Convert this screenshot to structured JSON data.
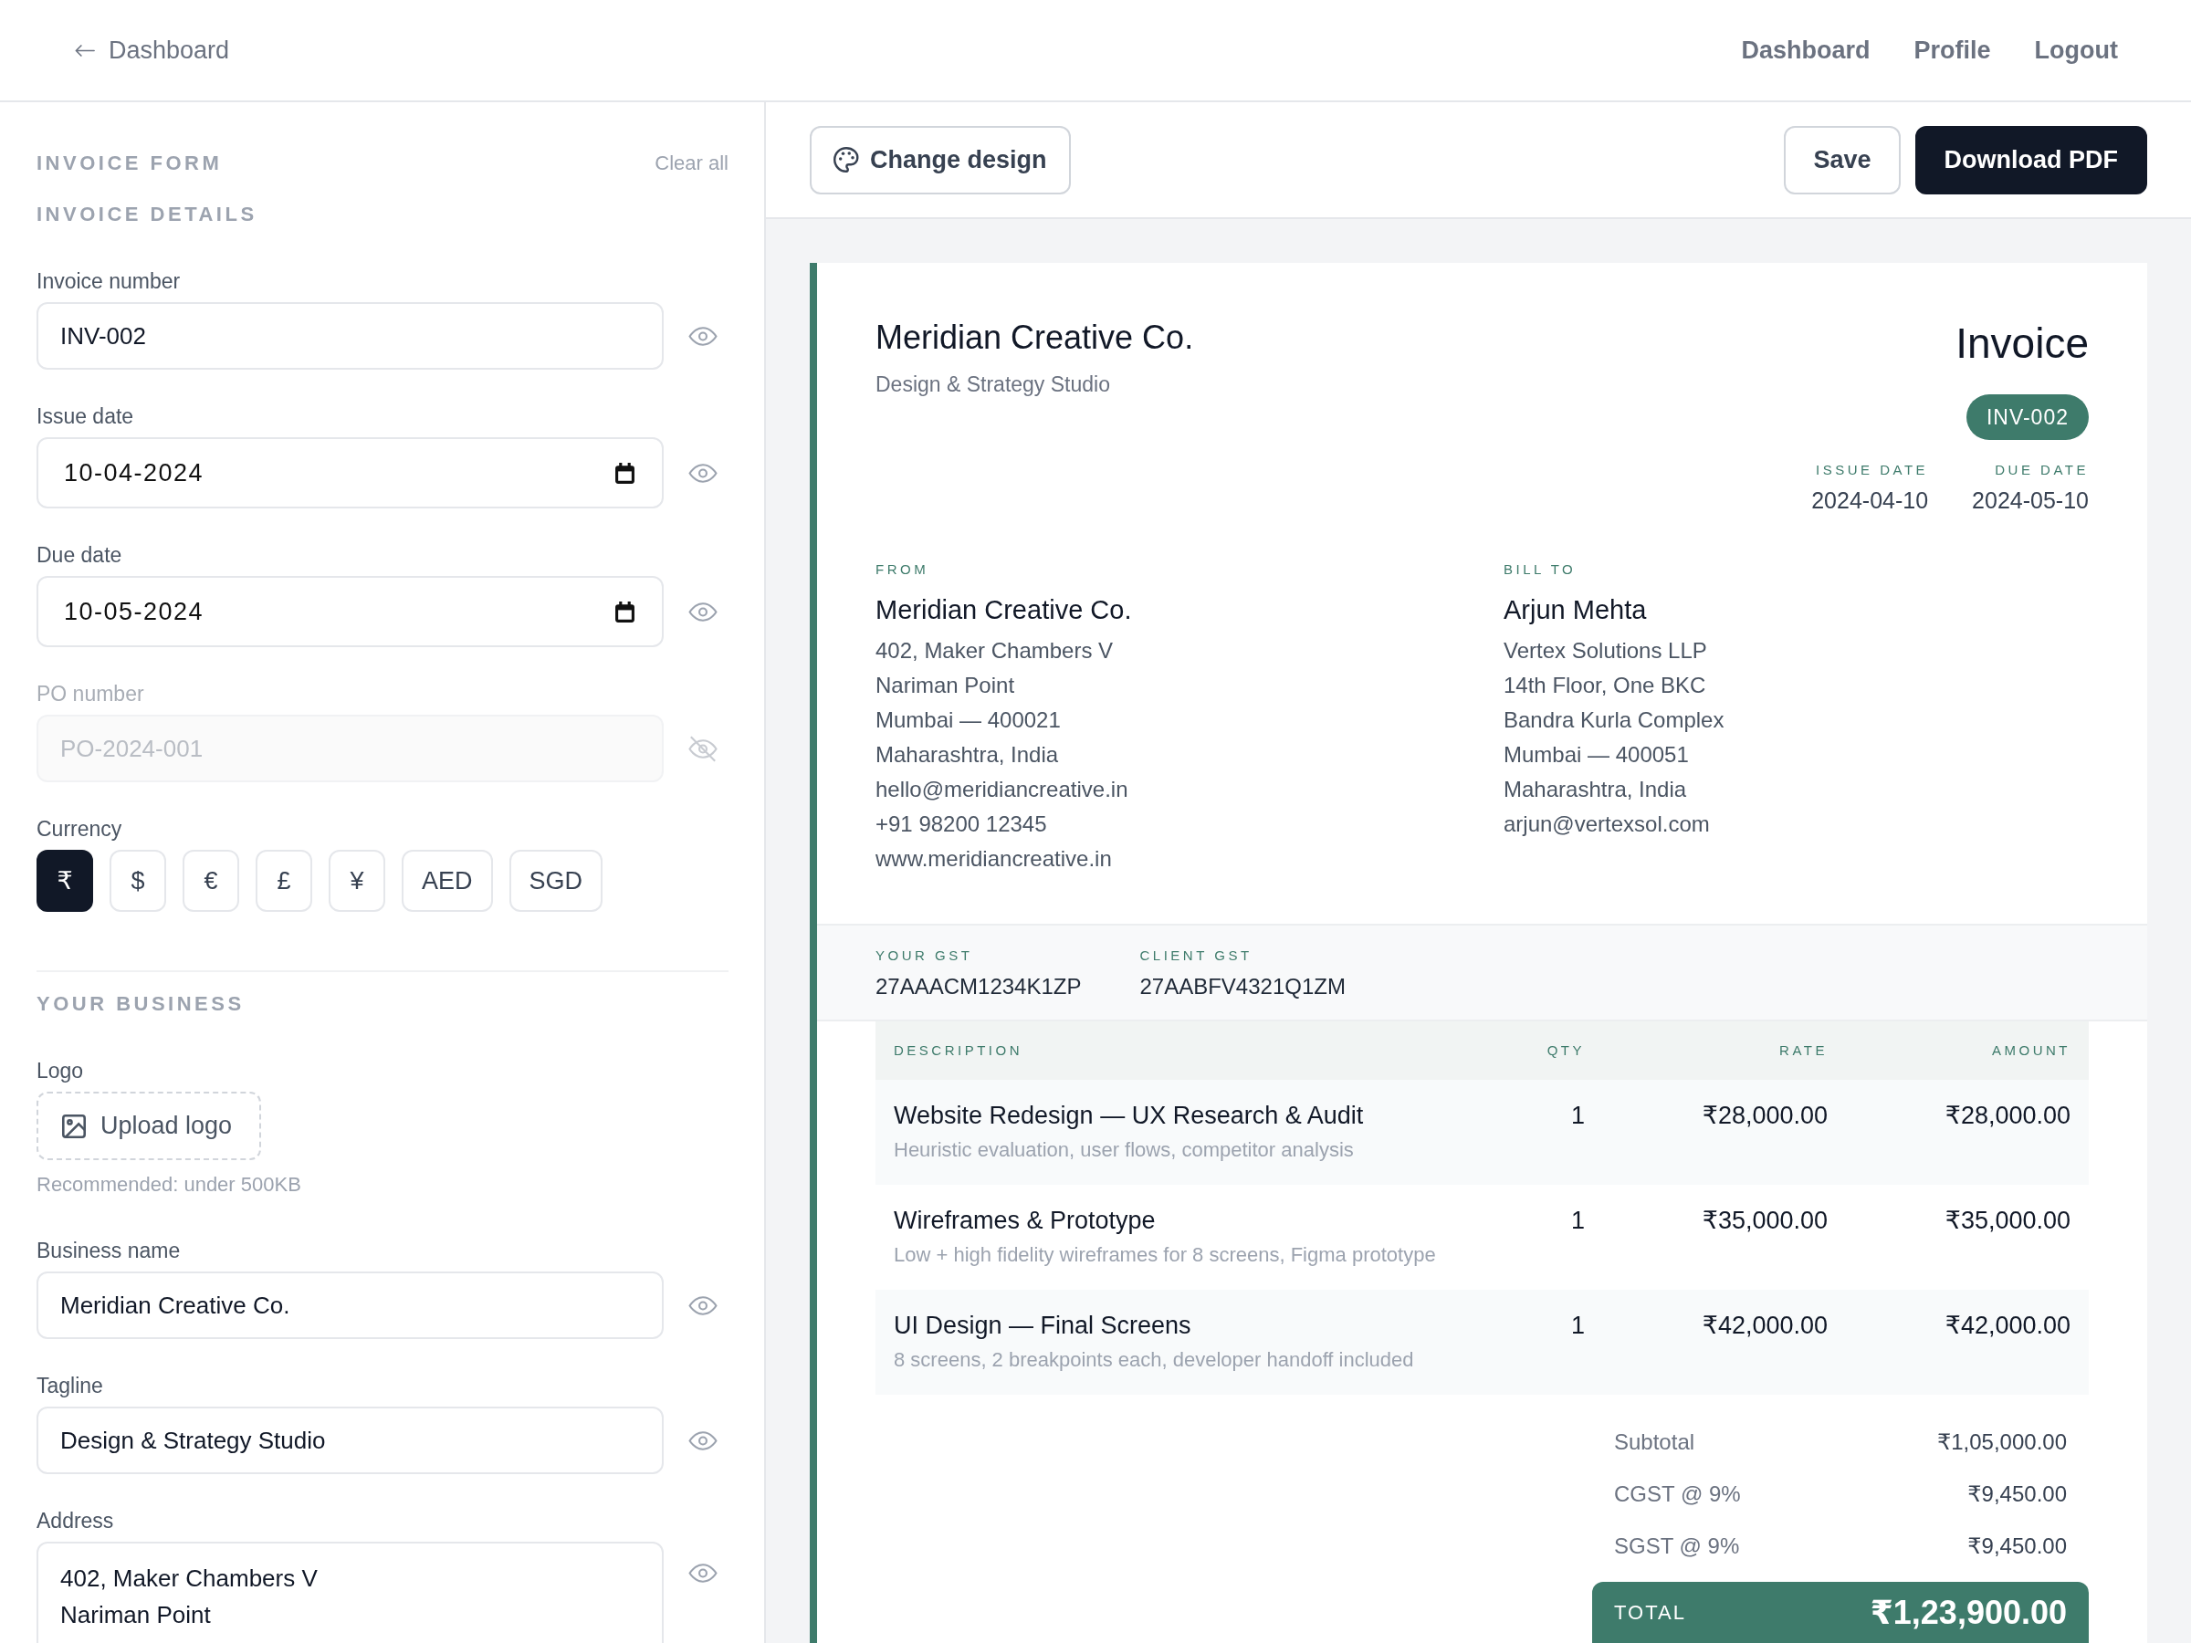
{
  "top_nav": {
    "back_link": "Dashboard",
    "links": [
      "Dashboard",
      "Profile",
      "Logout"
    ]
  },
  "form": {
    "title": "INVOICE FORM",
    "clear_all": "Clear all",
    "sections": [
      {
        "title": "INVOICE DETAILS",
        "fields": [
          {
            "kind": "text",
            "label": "Invoice number",
            "value": "INV-002",
            "visible": true
          },
          {
            "kind": "date",
            "label": "Issue date",
            "value": "10-04-2024",
            "visible": true
          },
          {
            "kind": "date",
            "label": "Due date",
            "value": "10-05-2024",
            "visible": true
          },
          {
            "kind": "text",
            "label": "PO number",
            "value": "PO-2024-001",
            "visible": false
          },
          {
            "kind": "currency",
            "label": "Currency",
            "options": [
              {
                "label": "₹",
                "selected": true
              },
              {
                "label": "$",
                "selected": false
              },
              {
                "label": "€",
                "selected": false
              },
              {
                "label": "£",
                "selected": false
              },
              {
                "label": "¥",
                "selected": false
              },
              {
                "label": "AED",
                "selected": false
              },
              {
                "label": "SGD",
                "selected": false
              }
            ]
          }
        ]
      },
      {
        "title": "YOUR BUSINESS",
        "fields": [
          {
            "kind": "upload",
            "label": "Logo",
            "button": "Upload logo",
            "hint": "Recommended: under 500KB"
          },
          {
            "kind": "text",
            "label": "Business name",
            "value": "Meridian Creative Co.",
            "visible": true
          },
          {
            "kind": "text",
            "label": "Tagline",
            "value": "Design & Strategy Studio",
            "visible": true
          },
          {
            "kind": "textarea",
            "label": "Address",
            "lines": [
              "402, Maker Chambers V",
              "Nariman Point"
            ],
            "visible": true
          }
        ]
      }
    ]
  },
  "toolbar": {
    "change_design": "Change design",
    "save": "Save",
    "download": "Download PDF"
  },
  "invoice": {
    "business_name": "Meridian Creative Co.",
    "tagline": "Design & Strategy Studio",
    "title": "Invoice",
    "number": "INV-002",
    "dates": [
      {
        "label": "ISSUE DATE",
        "value": "2024-04-10"
      },
      {
        "label": "DUE DATE",
        "value": "2024-05-10"
      }
    ],
    "parties": [
      {
        "label": "FROM",
        "name": "Meridian Creative Co.",
        "lines": [
          "402, Maker Chambers V",
          "Nariman Point",
          "Mumbai — 400021",
          "Maharashtra, India",
          "hello@meridiancreative.in",
          "+91 98200 12345",
          "www.meridiancreative.in"
        ]
      },
      {
        "label": "BILL TO",
        "name": "Arjun Mehta",
        "lines": [
          "Vertex Solutions LLP",
          "14th Floor, One BKC",
          "Bandra Kurla Complex",
          "Mumbai — 400051",
          "Maharashtra, India",
          "arjun@vertexsol.com"
        ]
      }
    ],
    "gst": [
      {
        "label": "YOUR GST",
        "value": "27AAACM1234K1ZP"
      },
      {
        "label": "CLIENT GST",
        "value": "27AABFV4321Q1ZM"
      }
    ],
    "table": {
      "columns": [
        "DESCRIPTION",
        "QTY",
        "RATE",
        "AMOUNT"
      ],
      "rows": [
        {
          "title": "Website Redesign — UX Research & Audit",
          "details": "Heuristic evaluation, user flows, competitor analysis",
          "qty": "1",
          "rate": "₹28,000.00",
          "amount": "₹28,000.00"
        },
        {
          "title": "Wireframes & Prototype",
          "details": "Low + high fidelity wireframes for 8 screens, Figma prototype",
          "qty": "1",
          "rate": "₹35,000.00",
          "amount": "₹35,000.00"
        },
        {
          "title": "UI Design — Final Screens",
          "details": "8 screens, 2 breakpoints each, developer handoff included",
          "qty": "1",
          "rate": "₹42,000.00",
          "amount": "₹42,000.00"
        }
      ]
    },
    "summary": [
      {
        "label": "Subtotal",
        "value": "₹1,05,000.00"
      },
      {
        "label": "CGST @ 9%",
        "value": "₹9,450.00"
      },
      {
        "label": "SGST @ 9%",
        "value": "₹9,450.00"
      }
    ],
    "total": {
      "label": "TOTAL",
      "value": "₹1,23,900.00"
    }
  }
}
